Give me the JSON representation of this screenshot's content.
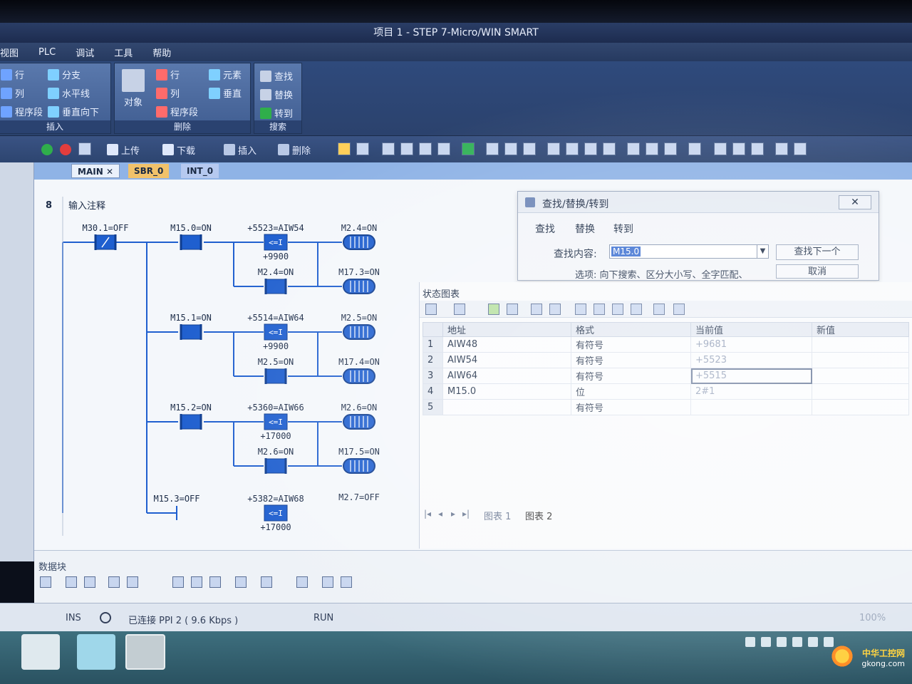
{
  "window": {
    "title": "项目 1 - STEP 7-Micro/WIN SMART"
  },
  "menu": [
    "视图",
    "PLC",
    "调试",
    "工具",
    "帮助"
  ],
  "ribbon": {
    "insert": {
      "title": "插入",
      "items": [
        "行",
        "列",
        "程序段",
        "分支",
        "水平线",
        "垂直向下"
      ]
    },
    "delete": {
      "title": "删除",
      "object": "对象",
      "items": [
        "行",
        "列",
        "程序段",
        "元素",
        "垂直"
      ]
    },
    "search": {
      "title": "搜索",
      "items": [
        "查找",
        "替换",
        "转到"
      ]
    }
  },
  "toolbar": {
    "upload": "上传",
    "download": "下载",
    "insert": "插入",
    "delete": "删除"
  },
  "tabs": [
    "MAIN",
    "SBR_0",
    "INT_0"
  ],
  "network": {
    "number": "8",
    "comment": "输入注释",
    "contacts": [
      "M30.1=OFF",
      "M15.0=ON",
      "M15.1=ON",
      "M15.2=ON",
      "M15.3=OFF",
      "M2.4=ON",
      "M2.5=ON",
      "M2.6=ON"
    ],
    "compares": [
      {
        "in": "+5523=AIW54",
        "op": "<=I",
        "ref": "+9900"
      },
      {
        "in": "+5514=AIW64",
        "op": "<=I",
        "ref": "+9900"
      },
      {
        "in": "+5360=AIW66",
        "op": "<=I",
        "ref": "+17000"
      },
      {
        "in": "+5382=AIW68",
        "op": "<=I",
        "ref": "+17000"
      }
    ],
    "coils": [
      "M2.4=ON",
      "M17.3=ON",
      "M2.5=ON",
      "M17.4=ON",
      "M2.6=ON",
      "M17.5=ON",
      "M2.7=OFF"
    ]
  },
  "find_dialog": {
    "title": "查找/替换/转到",
    "tabs": [
      "查找",
      "替换",
      "转到"
    ],
    "label": "查找内容:",
    "value": "M15.0",
    "find_next": "查找下一个",
    "cancel": "取消",
    "options": "选项:  向下搜索、区分大小写、全字匹配、"
  },
  "status_chart": {
    "title": "状态图表",
    "headers": [
      "地址",
      "格式",
      "当前值",
      "新值"
    ],
    "rows": [
      {
        "n": "1",
        "addr": "AIW48",
        "fmt": "有符号",
        "cur": "+9681",
        "new": ""
      },
      {
        "n": "2",
        "addr": "AIW54",
        "fmt": "有符号",
        "cur": "+5523",
        "new": ""
      },
      {
        "n": "3",
        "addr": "AIW64",
        "fmt": "有符号",
        "cur": "+5515",
        "new": ""
      },
      {
        "n": "4",
        "addr": "M15.0",
        "fmt": "位",
        "cur": "2#1",
        "new": ""
      },
      {
        "n": "5",
        "addr": "",
        "fmt": "有符号",
        "cur": "",
        "new": ""
      }
    ],
    "sheets": [
      "图表 1",
      "图表 2"
    ]
  },
  "data_block": {
    "title": "数据块"
  },
  "statusbar": {
    "mode": "INS",
    "connection": "已连接 PPI 2 ( 9.6 Kbps )",
    "state": "RUN",
    "zoom": "100%"
  },
  "watermark": {
    "line1": "中华工控网",
    "line2": "gkong.com"
  },
  "colors": {
    "ladder_blue": "#1f5fcf",
    "ribbon": "#3f5c90",
    "title": "#1d2c4f"
  }
}
